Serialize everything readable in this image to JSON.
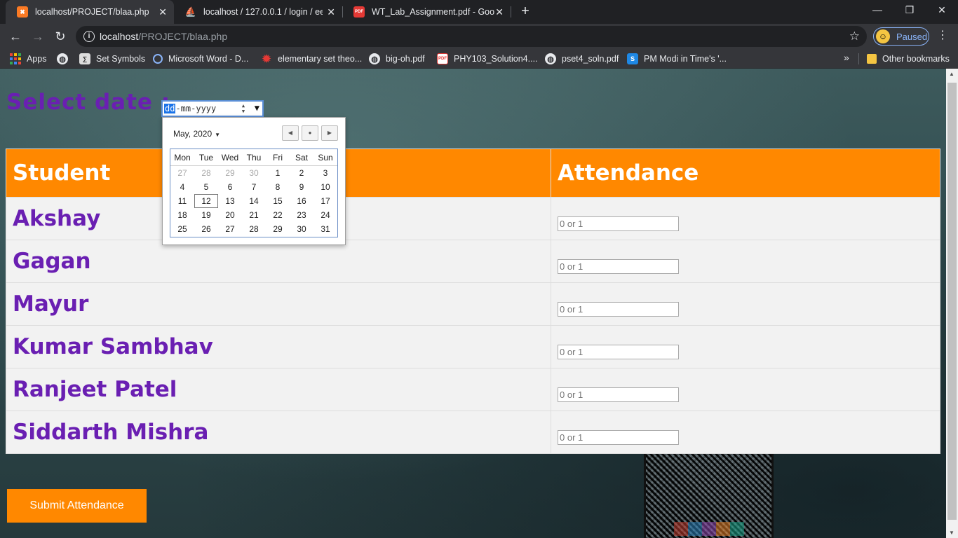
{
  "tabs": [
    {
      "title": "localhost/PROJECT/blaa.php",
      "favicon": "xampp-icon",
      "favicon_color": "#fb7a24",
      "active": true
    },
    {
      "title": "localhost / 127.0.0.1 / login / ee |",
      "favicon": "phpmyadmin-icon",
      "favicon_color": "#f89c0e",
      "active": false
    },
    {
      "title": "WT_Lab_Assignment.pdf - Google",
      "favicon": "pdf-icon",
      "favicon_color": "#e53935",
      "active": false
    }
  ],
  "address": {
    "host": "localhost",
    "path": "/PROJECT/blaa.php"
  },
  "profile": {
    "label": "Paused"
  },
  "bookmarks": [
    {
      "label": "Apps",
      "icon": "apps-grid-icon"
    },
    {
      "label": "",
      "icon": "globe-icon"
    },
    {
      "label": "Set Symbols",
      "icon": "set-symbols-icon"
    },
    {
      "label": "Microsoft Word - D...",
      "icon": "loading-icon"
    },
    {
      "label": "elementary set theo...",
      "icon": "red-gear-icon"
    },
    {
      "label": "big-oh.pdf",
      "icon": "globe-icon"
    },
    {
      "label": "PHY103_Solution4....",
      "icon": "pdf-icon"
    },
    {
      "label": "pset4_soln.pdf",
      "icon": "globe-icon"
    },
    {
      "label": "PM Modi in Time's '...",
      "icon": "s-icon"
    },
    {
      "label": "Other bookmarks",
      "icon": "folder-icon"
    }
  ],
  "page": {
    "select_label": "Select date :",
    "date_input": {
      "dd": "dd",
      "rest": "-mm-yyyy"
    },
    "calendar": {
      "month_label": "May, 2020",
      "weekdays": [
        "Mon",
        "Tue",
        "Wed",
        "Thu",
        "Fri",
        "Sat",
        "Sun"
      ],
      "weeks": [
        [
          "27",
          "28",
          "29",
          "30",
          "1",
          "2",
          "3"
        ],
        [
          "4",
          "5",
          "6",
          "7",
          "8",
          "9",
          "10"
        ],
        [
          "11",
          "12",
          "13",
          "14",
          "15",
          "16",
          "17"
        ],
        [
          "18",
          "19",
          "20",
          "21",
          "22",
          "23",
          "24"
        ],
        [
          "25",
          "26",
          "27",
          "28",
          "29",
          "30",
          "31"
        ]
      ],
      "muted_first_week_count": 4,
      "today": "12"
    },
    "table": {
      "headers": [
        "Student",
        "Attendance"
      ],
      "rows": [
        {
          "name": "Akshay",
          "placeholder": "0 or 1"
        },
        {
          "name": "Gagan",
          "placeholder": "0 or 1"
        },
        {
          "name": "Mayur",
          "placeholder": "0 or 1"
        },
        {
          "name": "Kumar Sambhav",
          "placeholder": "0 or 1"
        },
        {
          "name": "Ranjeet Patel",
          "placeholder": "0 or 1"
        },
        {
          "name": "Siddarth Mishra",
          "placeholder": "0 or 1"
        }
      ]
    },
    "submit_label": "Submit Attendance",
    "colors": {
      "accent": "#ff8800",
      "name_text": "#6a1fb2"
    }
  }
}
